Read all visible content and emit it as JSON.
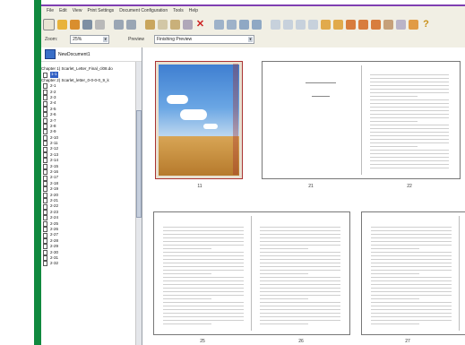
{
  "menu": [
    "File",
    "Edit",
    "View",
    "Print Settings",
    "Document Configuration",
    "Tools",
    "Help"
  ],
  "options": {
    "zoom_label": "Zoom:",
    "zoom_value": "25%",
    "preview_label": "Preview",
    "preview_value": "Finishing Preview"
  },
  "tree": {
    "root": "NewDocument1",
    "chapters": [
      "Chapter 1) Scarlet_Letter_Final_cl08.do",
      "Chapter 2) Scarlet_letter_0-0-0-0_9_k"
    ],
    "selected_item": "1-1",
    "items": [
      "2-1",
      "2-2",
      "2-3",
      "2-4",
      "2-5",
      "2-6",
      "2-7",
      "2-8",
      "2-9",
      "2-10",
      "2-11",
      "2-12",
      "2-13",
      "2-14",
      "2-15",
      "2-16",
      "2-17",
      "2-18",
      "2-19",
      "2-20",
      "2-21",
      "2-22",
      "2-23",
      "2-24",
      "2-25",
      "2-26",
      "2-27",
      "2-28",
      "2-29",
      "2-30",
      "2-31",
      "2-32"
    ]
  },
  "preview": {
    "cover_label": "11",
    "spread1_left": "21",
    "spread1_right": "22",
    "spread2_left": "25",
    "spread2_right": "26",
    "spread3_left": "27"
  },
  "colors": {
    "green_accent": "#10893f",
    "purple_line": "#7f3fb2",
    "app_bg": "#f1efe4",
    "selection": "#3160c4"
  }
}
